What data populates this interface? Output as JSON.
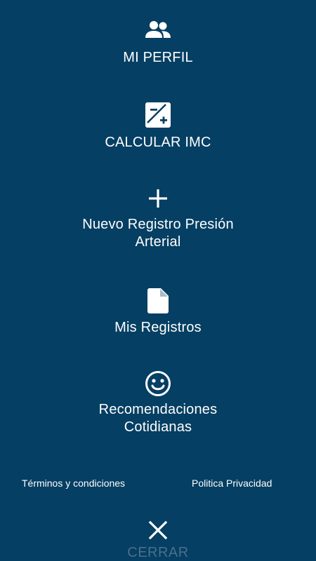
{
  "theme": {
    "background": "#053f63",
    "foreground": "#ffffff",
    "muted": "#4b6f8d"
  },
  "menu": {
    "items": [
      {
        "icon": "users-icon",
        "label": "MI PERFIL"
      },
      {
        "icon": "exposure-icon",
        "label": "CALCULAR IMC"
      },
      {
        "icon": "plus-icon",
        "label": "Nuevo Registro Presión Arterial"
      },
      {
        "icon": "document-icon",
        "label": "Mis Registros"
      },
      {
        "icon": "smile-icon",
        "label": "Recomendaciones Cotidianas"
      }
    ]
  },
  "footer": {
    "terms": "Términos y condiciones",
    "privacy": "Politica Privacidad"
  },
  "close": {
    "icon": "close-icon",
    "label": "CERRAR"
  }
}
